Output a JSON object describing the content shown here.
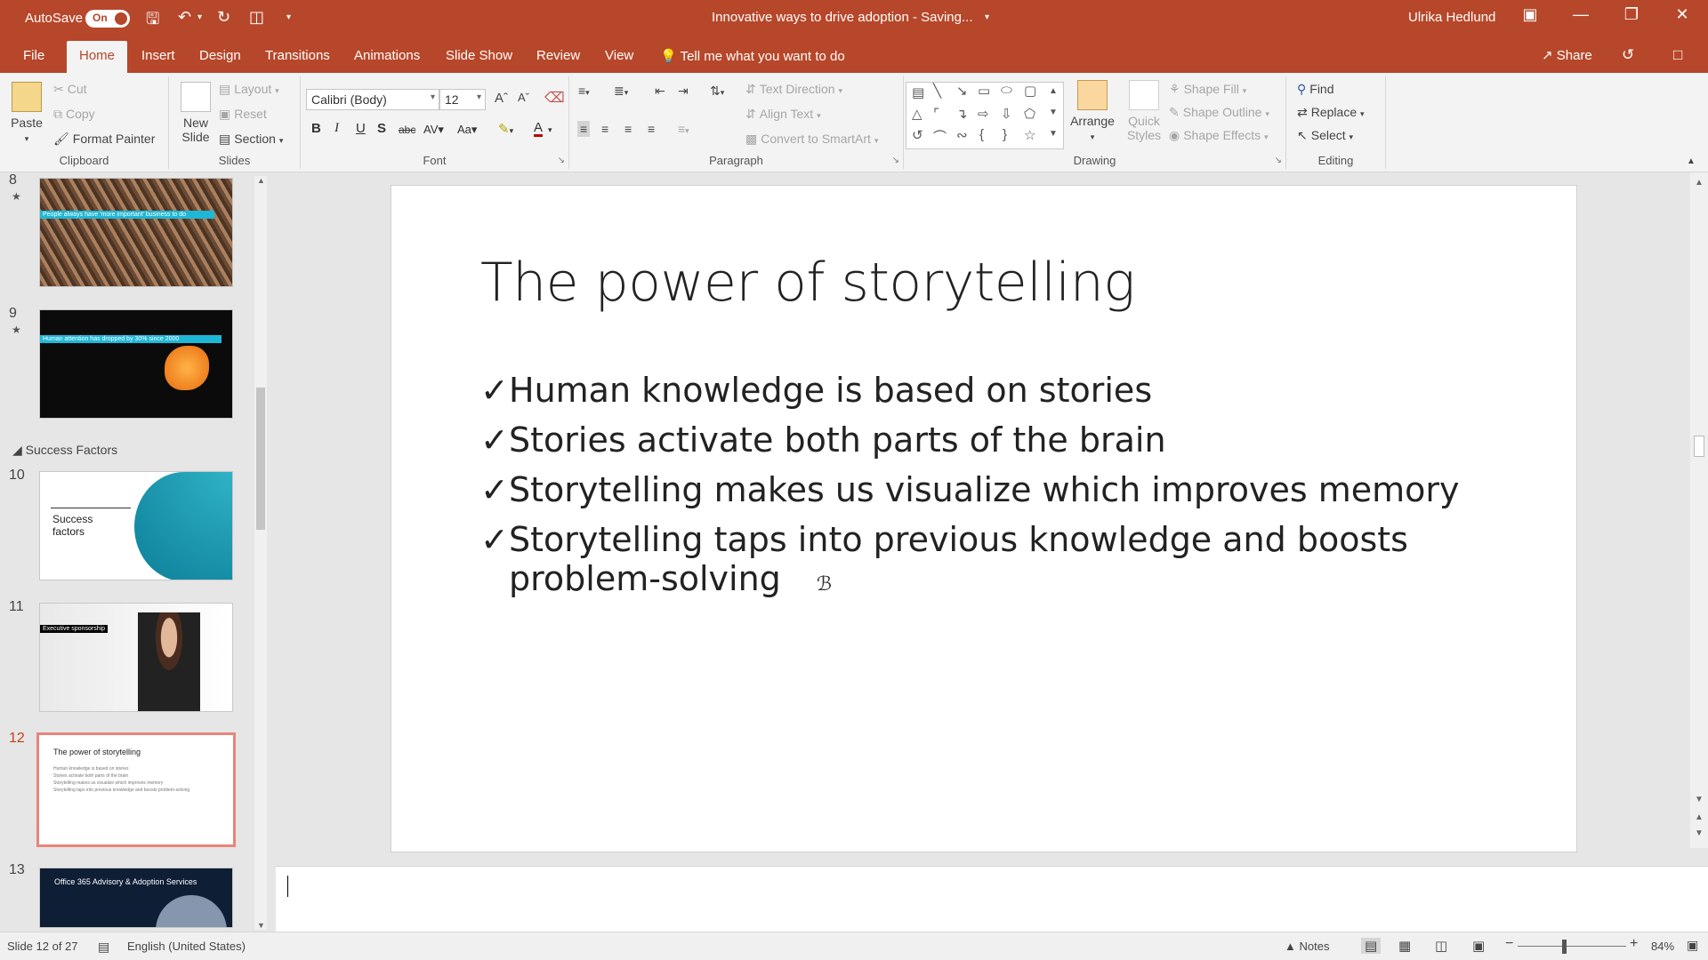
{
  "titlebar": {
    "autosave_label": "AutoSave",
    "autosave_state": "On",
    "document_title": "Innovative ways to drive adoption  -  Saving...",
    "user": "Ulrika Hedlund"
  },
  "tabs": [
    "File",
    "Home",
    "Insert",
    "Design",
    "Transitions",
    "Animations",
    "Slide Show",
    "Review",
    "View"
  ],
  "active_tab": "Home",
  "tell_me": "Tell me what you want to do",
  "share": "Share",
  "ribbon": {
    "clipboard": {
      "label": "Clipboard",
      "paste": "Paste",
      "cut": "Cut",
      "copy": "Copy",
      "format_painter": "Format Painter"
    },
    "slides": {
      "label": "Slides",
      "new_slide": "New Slide",
      "layout": "Layout",
      "reset": "Reset",
      "section": "Section"
    },
    "font": {
      "label": "Font",
      "font_name": "Calibri (Body)",
      "font_size": "12"
    },
    "paragraph": {
      "label": "Paragraph",
      "text_direction": "Text Direction",
      "align_text": "Align Text",
      "convert_smartart": "Convert to SmartArt"
    },
    "drawing": {
      "label": "Drawing",
      "arrange": "Arrange",
      "quick_styles": "Quick Styles",
      "shape_fill": "Shape Fill",
      "shape_outline": "Shape Outline",
      "shape_effects": "Shape Effects"
    },
    "editing": {
      "label": "Editing",
      "find": "Find",
      "replace": "Replace",
      "select": "Select"
    }
  },
  "thumbnails": {
    "section_name": "Success Factors",
    "slides": [
      {
        "num": "8",
        "caption": "People always have 'more important' business to do"
      },
      {
        "num": "9",
        "caption": "Human attention has dropped by 30% since 2000"
      },
      {
        "num": "10",
        "caption": "Success factors"
      },
      {
        "num": "11",
        "caption": "Executive sponsorship"
      },
      {
        "num": "12",
        "caption": "The power of storytelling"
      },
      {
        "num": "13",
        "caption": "Office 365 Advisory & Adoption Services"
      }
    ],
    "slide12_mini_bullets": [
      "Human knowledge is based on stories",
      "Stories activate both parts of the brain",
      "Storytelling makes us visualize which improves memory",
      "Storytelling taps into previous knowledge and boosts problem-solving"
    ]
  },
  "slide": {
    "title": "The power of storytelling",
    "bullets": [
      "Human knowledge is based on stories",
      "Stories activate both parts of the brain",
      "Storytelling makes us visualize which improves memory",
      "Storytelling taps into previous knowledge and boosts problem-solving"
    ]
  },
  "status": {
    "slide_info": "Slide 12 of 27",
    "language": "English (United States)",
    "notes": "Notes",
    "zoom": "84%"
  },
  "colors": {
    "accent": "#b7472a",
    "selection": "#e8847a"
  }
}
